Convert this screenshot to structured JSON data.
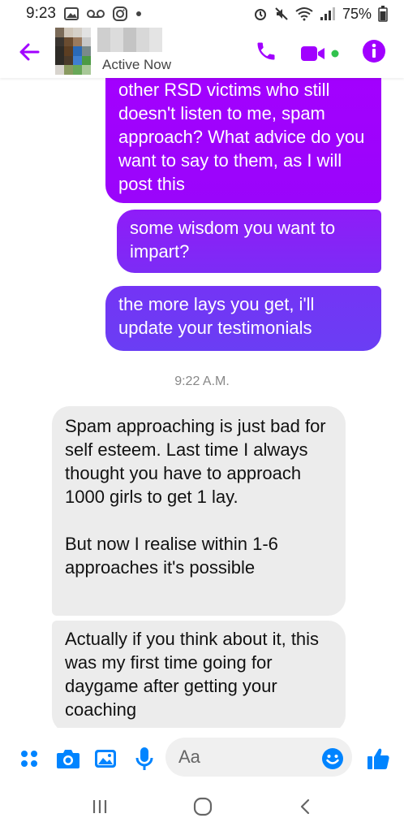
{
  "status_bar": {
    "time": "9:23",
    "battery": "75%"
  },
  "header": {
    "contact_status": "Active Now",
    "accent_color": "#a100ff",
    "icons": [
      "back-arrow-icon",
      "phone-icon",
      "video-camera-icon",
      "info-icon"
    ]
  },
  "messages": {
    "sent": [
      "other RSD victims who still doesn't listen to me, spam approach? What advice do you want to say to them, as I will post this",
      "some wisdom you want to impart?",
      "the more  lays you get,  i'll update your testimonials"
    ],
    "timestamp": "9:22 A.M.",
    "received": [
      "Spam approaching is just bad for self esteem. Last time I always thought you have to approach 1000 girls to get 1 lay.",
      "But now I realise within 1-6 approaches it's possible",
      "Actually if you think about it, this was my first time going for daygame after getting your coaching"
    ]
  },
  "composer": {
    "placeholder": "Aa",
    "icons": [
      "apps-icon",
      "camera-icon",
      "gallery-icon",
      "microphone-icon",
      "emoji-icon",
      "thumbs-up-icon"
    ]
  },
  "colors": {
    "gradient_top": "#a100ff",
    "gradient_bottom": "#6d3cf5",
    "received_bg": "#ececec",
    "icon_blue": "#0084ff"
  }
}
